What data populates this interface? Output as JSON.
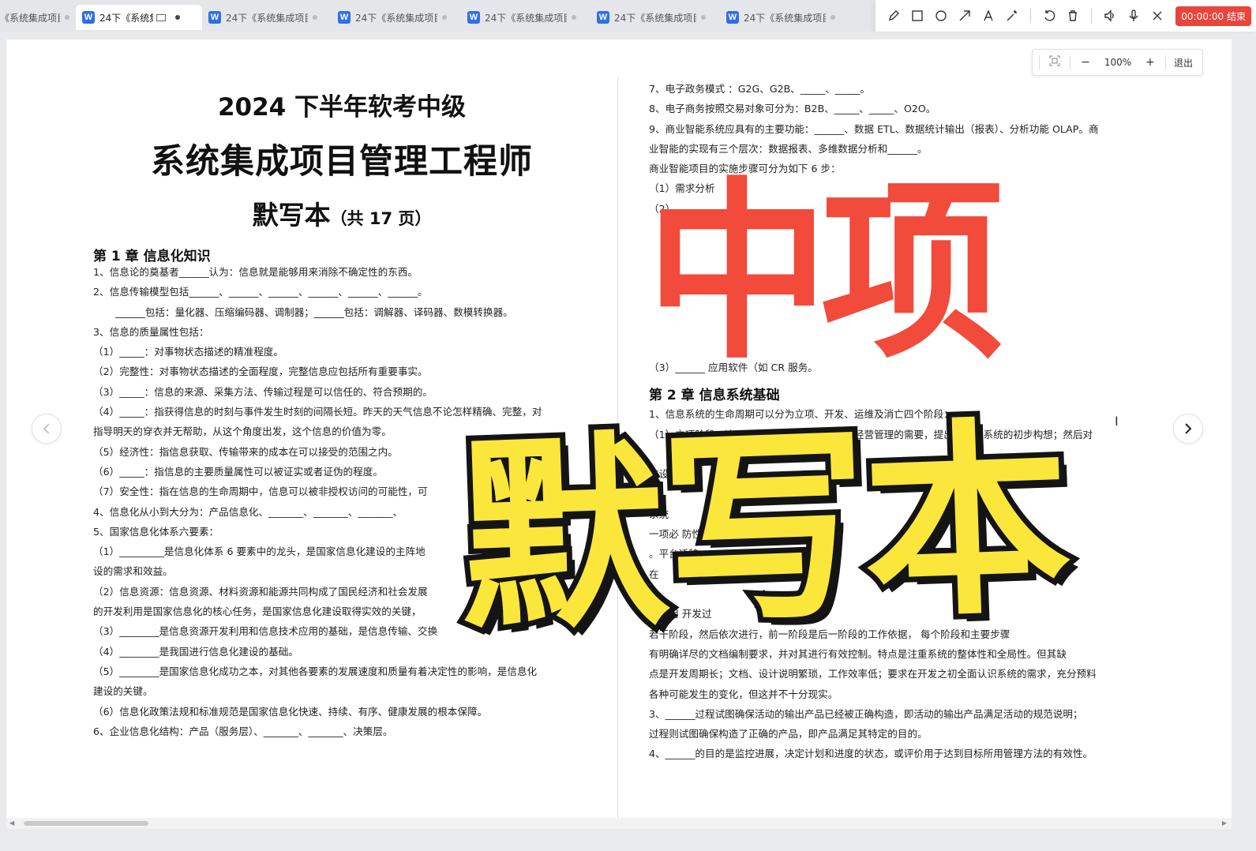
{
  "tabs": [
    {
      "label": "《系统集成项目",
      "active": false
    },
    {
      "label": "24下《系统集成项目",
      "active": true
    },
    {
      "label": "24下《系统集成项目",
      "active": false
    },
    {
      "label": "24下《系统集成项目",
      "active": false
    },
    {
      "label": "24下《系统集成项目",
      "active": false
    },
    {
      "label": "24下《系统集成项目",
      "active": false
    },
    {
      "label": "24下《系统集成项目",
      "active": false
    }
  ],
  "toolbar": {
    "timer": "00:00:00 结束",
    "icons": [
      "pencil-icon",
      "rectangle-icon",
      "circle-icon",
      "arrow-icon",
      "text-icon",
      "magic-wand-icon",
      "undo-icon",
      "trash-icon",
      "speaker-icon",
      "microphone-icon",
      "close-icon"
    ]
  },
  "zoom": {
    "value": "100%",
    "exit": "退出"
  },
  "left": {
    "title1": "2024 下半年软考中级",
    "title2": "系统集成项目管理工程师",
    "title3": "默写本",
    "title3_sub": "（共 17 页）",
    "chapter": "第 1 章 信息化知识",
    "lines": [
      "1、信息论的奠基者______认为：信息就是能够用来消除不确定性的东西。",
      "2、信息传输模型包括______、______、______、______、______、______。",
      "______包括：量化器、压缩编码器、调制器；______包括：调解器、译码器、数模转换器。",
      "3、信息的质量属性包括：",
      "（1）_____：对事物状态描述的精准程度。",
      "（2）完整性：对事物状态描述的全面程度，完整信息应包括所有重要事实。",
      "（3）_____：信息的来源、采集方法、传输过程是可以信任的、符合预期的。",
      "（4）_____：指获得信息的时刻与事件发生时刻的间隔长短。昨天的天气信息不论怎样精确、完整，对",
      "指导明天的穿衣并无帮助，从这个角度出发，这个信息的价值为零。",
      "（5）经济性：指信息获取、传输带来的成本在可以接受的范围之内。",
      "（6）_____：指信息的主要质量属性可以被证实或者证伪的程度。",
      "（7）安全性：指在信息的生命周期中，信息可以被非授权访问的可能性，可",
      "4、信息化从小到大分为：产品信息化、_______、_______、_______、",
      "5、国家信息化体系六要素：",
      "（1）_________是信息化体系 6 要素中的龙头，是国家信息化建设的主阵地",
      "设的需求和效益。",
      "（2）信息资源：信息资源、材料资源和能源共同构成了国民经济和社会发展",
      "的开发利用是国家信息化的核心任务，是国家信息化建设取得实效的关键，",
      "（3）________是信息资源开发利用和信息技术应用的基础，是信息传输、交换",
      "（4）________是我国进行信息化建设的基础。",
      "（5）________是国家信息化成功之本，对其他各要素的发展速度和质量有着决定性的影响，是信息化",
      "建设的关键。",
      "（6）信息化政策法规和标准规范是国家信息化快速、持续、有序、健康发展的根本保障。",
      "6、企业信息化结构：产品（服务层）、_______、_______、决策层。"
    ]
  },
  "right": {
    "lines_a": [
      "7、电子政务模式 ：G2G、G2B、_____、_____。",
      "8、电子商务按照交易对象可分为：B2B、_____、_____、O2O。",
      "9、商业智能系统应具有的主要功能：______、数据 ETL、数据统计输出（报表）、分析功能 OLAP。商",
      "业智能的实现有三个层次：数据报表、多维数据分析和______。",
      "商业智能项目的实施步骤可分为如下 6 步：",
      "（1）需求分析",
      "（2）______"
    ],
    "line_b": "（3）______              应用软件（如 CR                                                        服务。",
    "chapter": "第 2 章 信息系统基础",
    "lines_c": [
      "1、信息系统的生命周期可以分为立项、开发、运维及消亡四个阶段：",
      "（1）立项阶段：这一阶段根据用户业务发展和经营管理的需要，提出建设该系统的初步构想；然后对",
      "",
      "                                                                                                    统设",
      "",
      "                                                                                                    系统",
      "        一项必                                                                                防性维护等类",
      "。平台迁移",
      "                                                                                                    在",
      "",
      "                    是应用                                                                    开发过",
      "              若干阶段，然后依次进行，前一阶段是后一阶段的工作依据，     每个阶段和主要步骤",
      "有明确详尽的文档编制要求，并对其进行有效控制。特点是注重系统的整体性和全局性。但其缺",
      "点是开发周期长；文档、设计说明繁琐，工作效率低；要求在开发之初全面认识系统的需求，充分预料",
      "各种可能发生的变化，但这并不十分现实。",
      "3、______过程试图确保活动的输出产品已经被正确构造，即活动的输出产品满足活动的规范说明；",
      "过程则试图确保构造了正确的产品，即产品满足其特定的目的。",
      "4、______的目的是监控进展，决定计划和进度的状态，或评价用于达到目标所用管理方法的有效性。"
    ]
  },
  "overlay": {
    "line1": "中项",
    "line2": "默写本",
    "colors": {
      "red": "#f24a3b",
      "yellow": "#fbe63b"
    }
  }
}
